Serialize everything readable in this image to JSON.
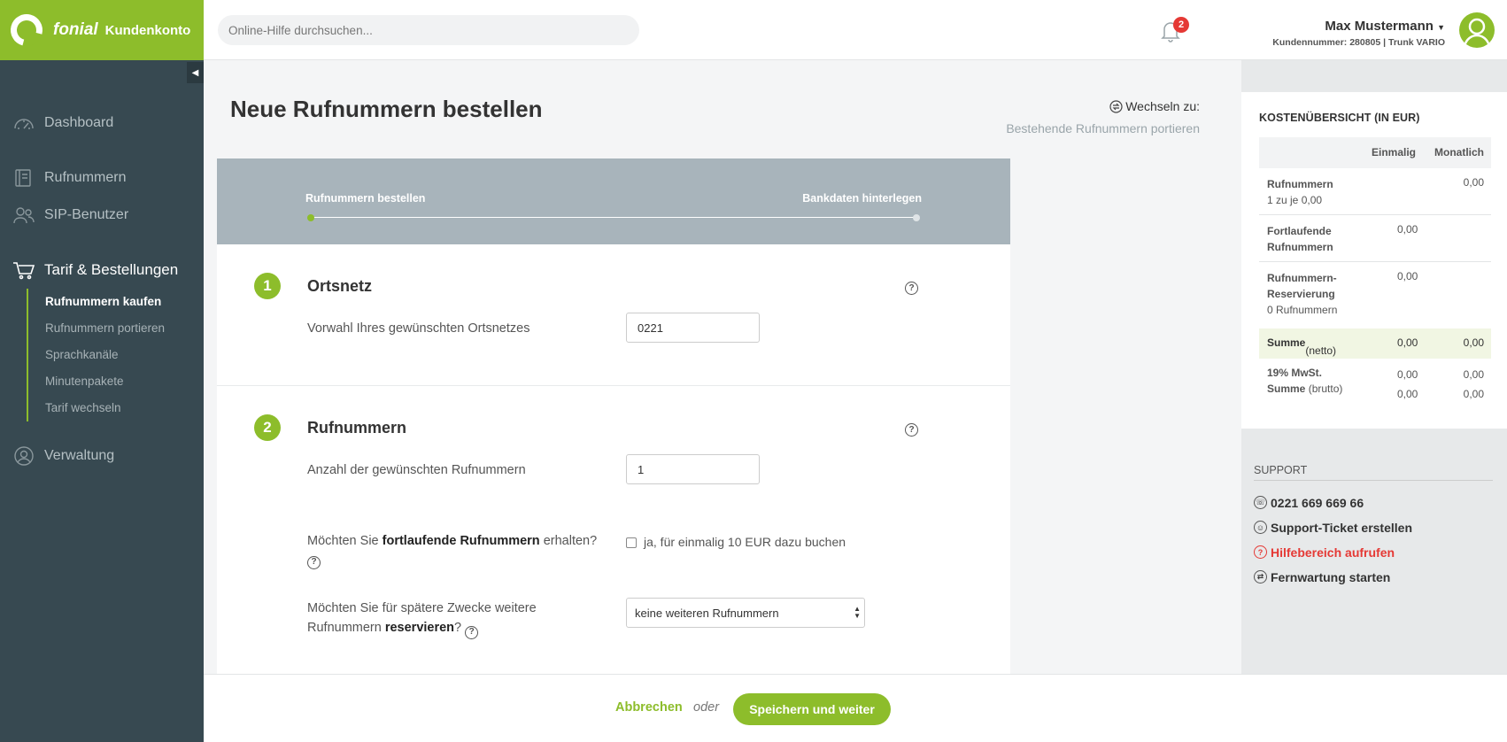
{
  "brand": {
    "name": "fonial",
    "sub": "Kundenkonto"
  },
  "search": {
    "placeholder": "Online-Hilfe durchsuchen..."
  },
  "notifications": {
    "count": "2"
  },
  "user": {
    "name": "Max Mustermann",
    "sub": "Kundennummer: 280805 | Trunk VARIO"
  },
  "sidebar": {
    "items": [
      {
        "label": "Dashboard",
        "icon": "gauge-icon"
      },
      {
        "label": "Rufnummern",
        "icon": "phone-book-icon"
      },
      {
        "label": "SIP-Benutzer",
        "icon": "users-icon"
      },
      {
        "label": "Tarif & Bestellungen",
        "icon": "cart-icon"
      },
      {
        "label": "Verwaltung",
        "icon": "person-circle-icon"
      }
    ],
    "subitems": [
      "Rufnummern kaufen",
      "Rufnummern portieren",
      "Sprachkanäle",
      "Minutenpakete",
      "Tarif wechseln"
    ]
  },
  "page": {
    "title": "Neue Rufnummern bestellen",
    "switch_label": "Wechseln zu:",
    "switch_link": "Bestehende Rufnummern portieren"
  },
  "steps": {
    "left": "Rufnummern bestellen",
    "right": "Bankdaten hinterlegen"
  },
  "section1": {
    "num": "1",
    "title": "Ortsnetz",
    "label": "Vorwahl Ihres gewünschten Ortsnetzes",
    "value": "0221"
  },
  "section2": {
    "num": "2",
    "title": "Rufnummern",
    "count_label": "Anzahl der gewünschten Rufnummern",
    "count_value": "1",
    "cont_prefix": "Möchten Sie ",
    "cont_bold": "fortlaufende Rufnummern",
    "cont_suffix": " erhalten?",
    "cont_checkbox": "ja, für einmalig 10 EUR dazu buchen",
    "res_prefix": "Möchten Sie für spätere Zwecke weitere Rufnummern ",
    "res_bold": "reservieren",
    "res_suffix": "?",
    "res_select": "keine weiteren Rufnummern"
  },
  "cost": {
    "title": "KOSTENÜBERSICHT (IN EUR)",
    "col1": "Einmalig",
    "col2": "Monatlich",
    "rows": [
      {
        "name": "Rufnummern",
        "sub": "1 zu je 0,00",
        "v1": "",
        "v2": "0,00"
      },
      {
        "name": "Fortlaufende Rufnummern",
        "sub": "",
        "v1": "0,00",
        "v2": ""
      },
      {
        "name": "Rufnummern-Reservierung",
        "sub": "0 Rufnummern",
        "v1": "0,00",
        "v2": ""
      }
    ],
    "sum_label": "Summe",
    "sum_sub": "(netto)",
    "sum_v1": "0,00",
    "sum_v2": "0,00",
    "mwst_label": "19% MwSt.",
    "mwst_v1": "0,00",
    "mwst_v2": "0,00",
    "brutto_label": "Summe",
    "brutto_sub": "(brutto)",
    "brutto_v1": "0,00",
    "brutto_v2": "0,00"
  },
  "support": {
    "title": "SUPPORT",
    "phone": "0221 669 669 66",
    "ticket": "Support-Ticket erstellen",
    "help": "Hilfebereich aufrufen",
    "remote": "Fernwartung starten"
  },
  "footer": {
    "cancel": "Abbrechen",
    "or": "oder",
    "save": "Speichern und weiter"
  },
  "colors": {
    "brand": "#8dbd2b",
    "sidebar": "#374951",
    "alert": "#e53935"
  }
}
